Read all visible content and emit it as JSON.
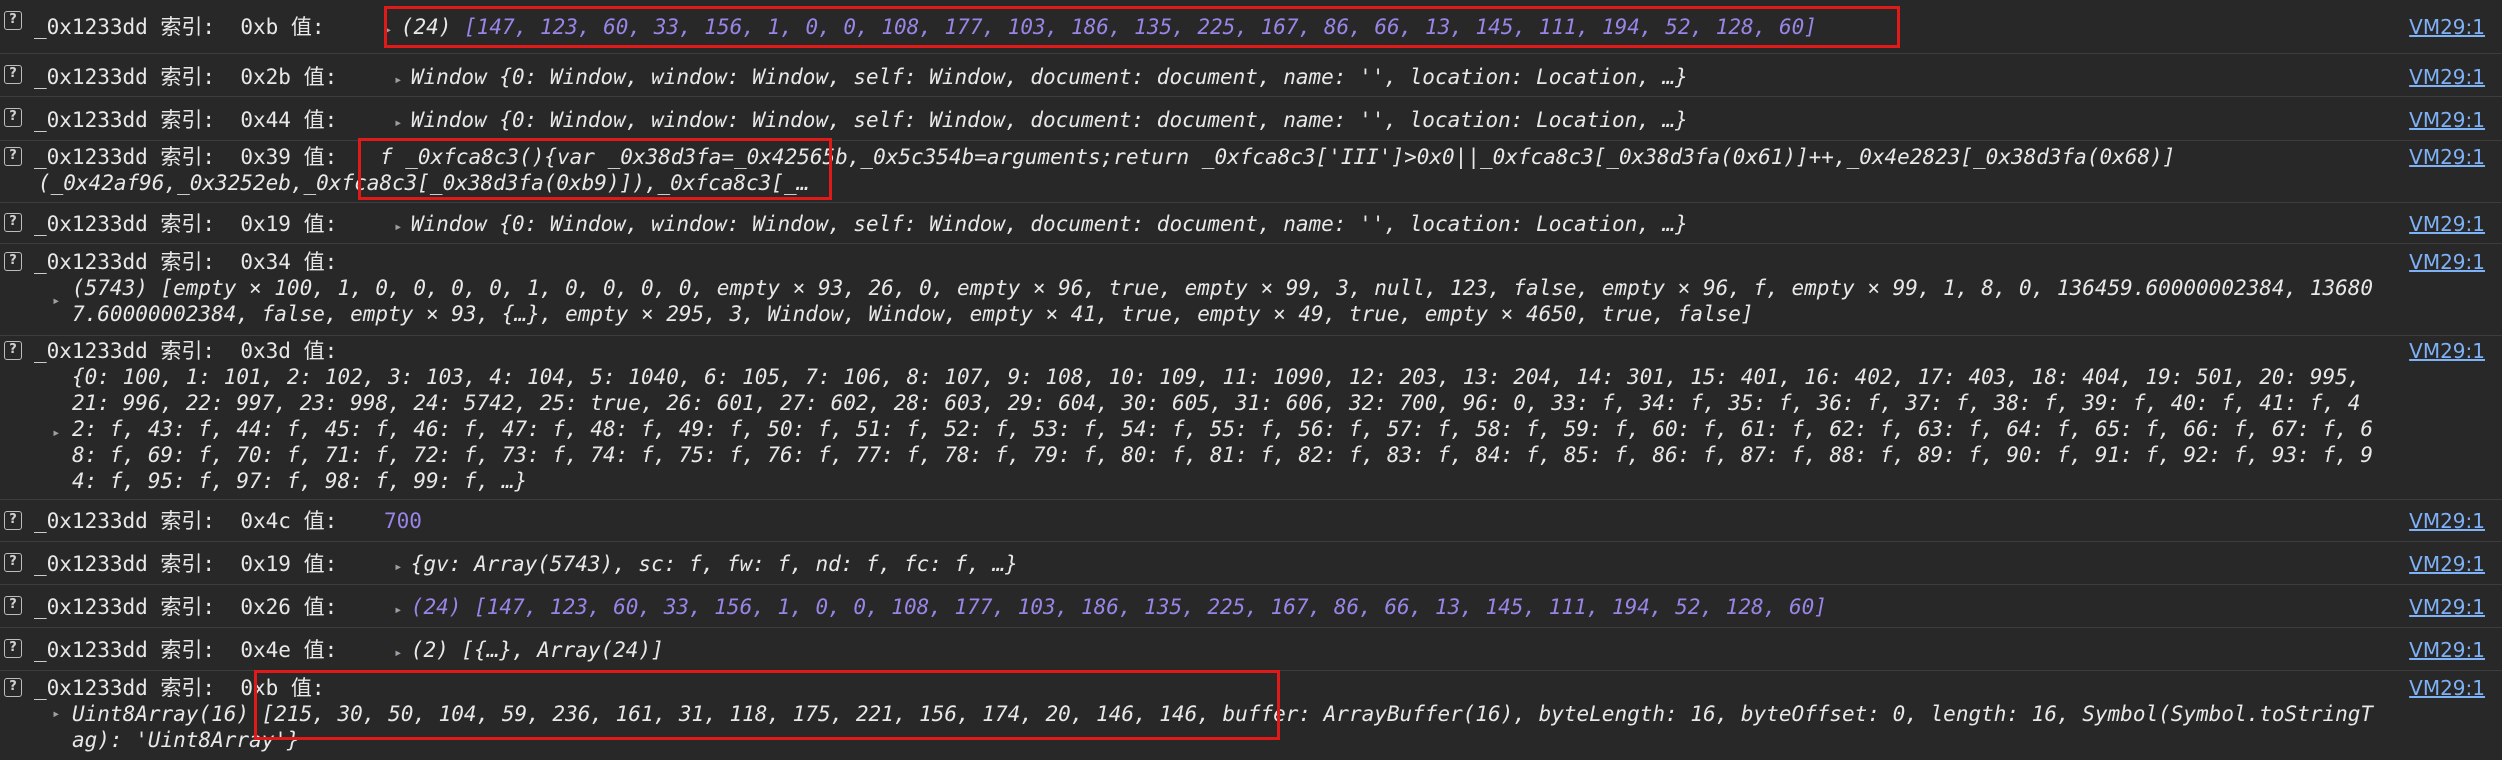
{
  "console_rows": [
    {
      "prefix": "_0x1233dd 索引:  0xb 值:",
      "value": "[147, 123, 60, 33, 156, 1, 0, 0, 108, 177, 103, 186, 135, 225, 167, 86, 66, 13, 145, 111, 194, 52, 128, 60]",
      "count": "(24)",
      "source": "VM29:1"
    },
    {
      "prefix": "_0x1233dd 索引:  0x2b 值:",
      "value": "Window {0: Window, window: Window, self: Window, document: document, name: '', location: Location, …}",
      "source": "VM29:1"
    },
    {
      "prefix": "_0x1233dd 索引:  0x44 值:",
      "value": "Window {0: Window, window: Window, self: Window, document: document, name: '', location: Location, …}",
      "source": "VM29:1"
    },
    {
      "prefix": "_0x1233dd 索引:  0x39 值:",
      "value_line1": "f _0xfca8c3(){var _0x38d3fa=_0x42565b,_0x5c354b=arguments;return _0xfca8c3['III']>0x0||_0xfca8c3[_0x38d3fa(0x61)]++,_0x4e2823[_0x38d3fa(0x68)]",
      "value_line2": "(_0x42af96,_0x3252eb,_0xfca8c3[_0x38d3fa(0xb9)]),_0xfca8c3[_…",
      "source": "VM29:1"
    },
    {
      "prefix": "_0x1233dd 索引:  0x19 值:",
      "value": "Window {0: Window, window: Window, self: Window, document: document, name: '', location: Location, …}",
      "source": "VM29:1"
    },
    {
      "prefix": "_0x1233dd 索引:  0x34 值:",
      "value_line1": "(5743) [empty × 100, 1, 0, 0, 0, 0, 1, 0, 0, 0, 0, empty × 93, 26, 0, empty × 96, true, empty × 99, 3, null, 123, false, empty × 96, f, empty × 99, 1, 8, 0, 136459.60000002384, 13680",
      "value_line2": "7.60000002384, false, empty × 93, {…}, empty × 295, 3, Window, Window, empty × 41, true, empty × 49, true, empty × 4650, true, false]",
      "source": "VM29:1"
    },
    {
      "prefix": "_0x1233dd 索引:  0x3d 值:",
      "value_line1": "{0: 100, 1: 101, 2: 102, 3: 103, 4: 104, 5: 1040, 6: 105, 7: 106, 8: 107, 9: 108, 10: 109, 11: 1090, 12: 203, 13: 204, 14: 301, 15: 401, 16: 402, 17: 403, 18: 404, 19: 501, 20: 995,",
      "value_line2": "21: 996, 22: 997, 23: 998, 24: 5742, 25: true, 26: 601, 27: 602, 28: 603, 29: 604, 30: 605, 31: 606, 32: 700, 96: 0, 33: f, 34: f, 35: f, 36: f, 37: f, 38: f, 39: f, 40: f, 41: f, 4",
      "value_line3": "2: f, 43: f, 44: f, 45: f, 46: f, 47: f, 48: f, 49: f, 50: f, 51: f, 52: f, 53: f, 54: f, 55: f, 56: f, 57: f, 58: f, 59: f, 60: f, 61: f, 62: f, 63: f, 64: f, 65: f, 66: f, 67: f, 6",
      "value_line4": "8: f, 69: f, 70: f, 71: f, 72: f, 73: f, 74: f, 75: f, 76: f, 77: f, 78: f, 79: f, 80: f, 81: f, 82: f, 83: f, 84: f, 85: f, 86: f, 87: f, 88: f, 89: f, 90: f, 91: f, 92: f, 93: f, 9",
      "value_line5": "4: f, 95: f, 97: f, 98: f, 99: f, …}",
      "source": "VM29:1"
    },
    {
      "prefix": "_0x1233dd 索引:  0x4c 值:",
      "value": "700",
      "source": "VM29:1"
    },
    {
      "prefix": "_0x1233dd 索引:  0x19 值:",
      "value": "{gv: Array(5743), sc: f, fw: f, nd: f, fc: f, …}",
      "source": "VM29:1"
    },
    {
      "prefix": "_0x1233dd 索引:  0x26 值:",
      "value": "(24) [147, 123, 60, 33, 156, 1, 0, 0, 108, 177, 103, 186, 135, 225, 167, 86, 66, 13, 145, 111, 194, 52, 128, 60]",
      "source": "VM29:1"
    },
    {
      "prefix": "_0x1233dd 索引:  0x4e 值:",
      "value": "(2) [{…}, Array(24)]",
      "source": "VM29:1"
    },
    {
      "prefix": "_0x1233dd 索引:  0xb 值:",
      "value_line1": "Uint8Array(16) [215, 30, 50, 104, 59, 236, 161, 31, 118, 175, 221, 156, 174, 20, 146, 146, buffer: ArrayBuffer(16), byteLength: 16, byteOffset: 0, length: 16, Symbol(Symbol.toStringT",
      "value_line2": "ag): 'Uint8Array'}",
      "source": "VM29:1"
    }
  ],
  "colors": {
    "background": "#282828",
    "number": "#9985e6",
    "string": "#5ed2ff",
    "keyword": "#c792ea",
    "link": "#7fb1f5",
    "highlight_box": "#e01919"
  },
  "icons": {
    "row_badge": "help-question-badge",
    "expand": "triangle-right-icon"
  }
}
